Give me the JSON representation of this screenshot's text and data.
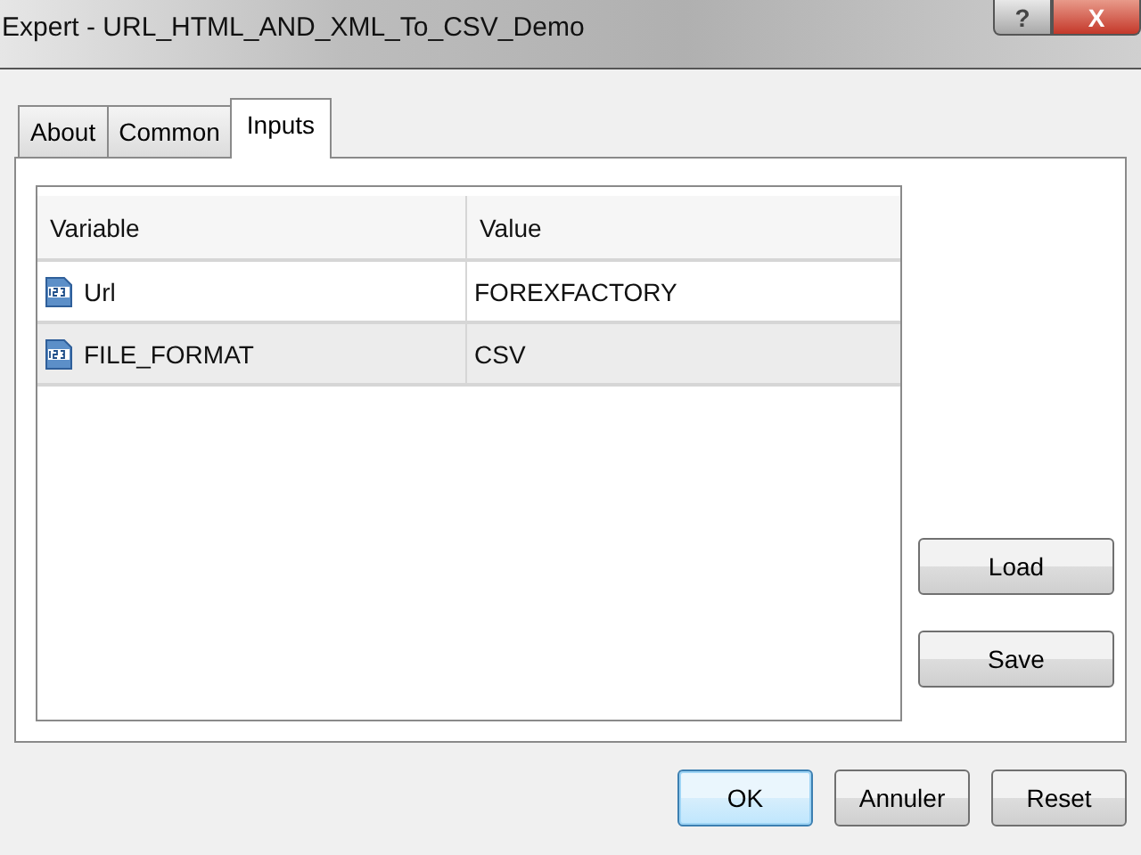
{
  "window": {
    "title": "Expert - URL_HTML_AND_XML_To_CSV_Demo",
    "help_button": "?",
    "close_button": "X"
  },
  "tabs": [
    {
      "label": "About",
      "selected": false
    },
    {
      "label": "Common",
      "selected": false
    },
    {
      "label": "Inputs",
      "selected": true
    }
  ],
  "table": {
    "columns": [
      "Variable",
      "Value"
    ],
    "rows": [
      {
        "variable": "Url",
        "value": "FOREXFACTORY",
        "selected": false
      },
      {
        "variable": "FILE_FORMAT",
        "value": "CSV",
        "selected": true
      }
    ]
  },
  "side_buttons": [
    "Load",
    "Save"
  ],
  "buttons": [
    {
      "label": "OK",
      "default": true
    },
    {
      "label": "Annuler",
      "default": false
    },
    {
      "label": "Reset",
      "default": false
    }
  ]
}
